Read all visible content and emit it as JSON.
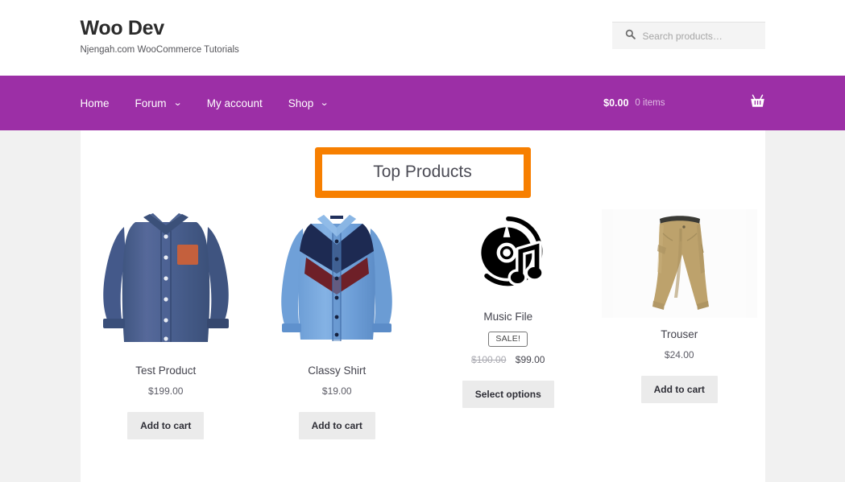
{
  "header": {
    "site_title": "Woo Dev",
    "site_description": "Njengah.com WooCommerce Tutorials",
    "search": {
      "placeholder": "Search products…",
      "value": "",
      "icon": "search-icon"
    }
  },
  "nav": {
    "items": [
      {
        "label": "Home",
        "has_dropdown": false
      },
      {
        "label": "Forum",
        "has_dropdown": true
      },
      {
        "label": "My account",
        "has_dropdown": false
      },
      {
        "label": "Shop",
        "has_dropdown": true
      }
    ],
    "caret_glyph": "⌄",
    "cart": {
      "amount": "$0.00",
      "count": "0 items",
      "icon": "shopping-basket-icon"
    },
    "background_color": "#9c2fa6"
  },
  "main": {
    "section_heading": "Top Products",
    "heading_border_color": "#f77f00",
    "products": [
      {
        "title": "Test Product",
        "price": "$199.00",
        "button_label": "Add to cart",
        "on_sale": false,
        "image_name": "blue-denim-shirt-image"
      },
      {
        "title": "Classy Shirt",
        "price": "$19.00",
        "button_label": "Add to cart",
        "on_sale": false,
        "image_name": "blue-chevron-shirt-image"
      },
      {
        "title": "Music File",
        "sale_badge": "SALE!",
        "price_old": "$100.00",
        "price_new": "$99.00",
        "button_label": "Select options",
        "on_sale": true,
        "image_name": "music-cd-icon-image"
      },
      {
        "title": "Trouser",
        "price": "$24.00",
        "button_label": "Add to cart",
        "on_sale": false,
        "image_name": "khaki-trouser-image"
      }
    ]
  }
}
